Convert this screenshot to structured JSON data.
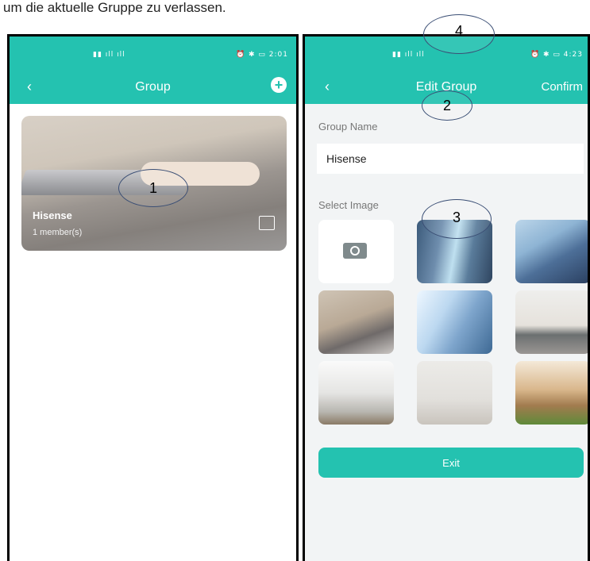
{
  "caption": "um die aktuelle Gruppe zu verlassen.",
  "colors": {
    "accent": "#24c2b0",
    "background": "#f2f4f5"
  },
  "left": {
    "status_time": "2:01",
    "title": "Group",
    "back_icon": "chevron-left-icon",
    "add_icon": "plus-circle-icon",
    "card": {
      "name": "Hisense",
      "member_count": "1 member(s)",
      "edit_icon": "edit-icon"
    }
  },
  "right": {
    "status_time": "4:23",
    "title": "Edit Group",
    "confirm_label": "Confirm",
    "group_name_label": "Group Name",
    "group_name_value": "Hisense",
    "select_image_label": "Select Image",
    "exit_label": "Exit"
  },
  "callouts": [
    "1",
    "2",
    "3",
    "4"
  ]
}
